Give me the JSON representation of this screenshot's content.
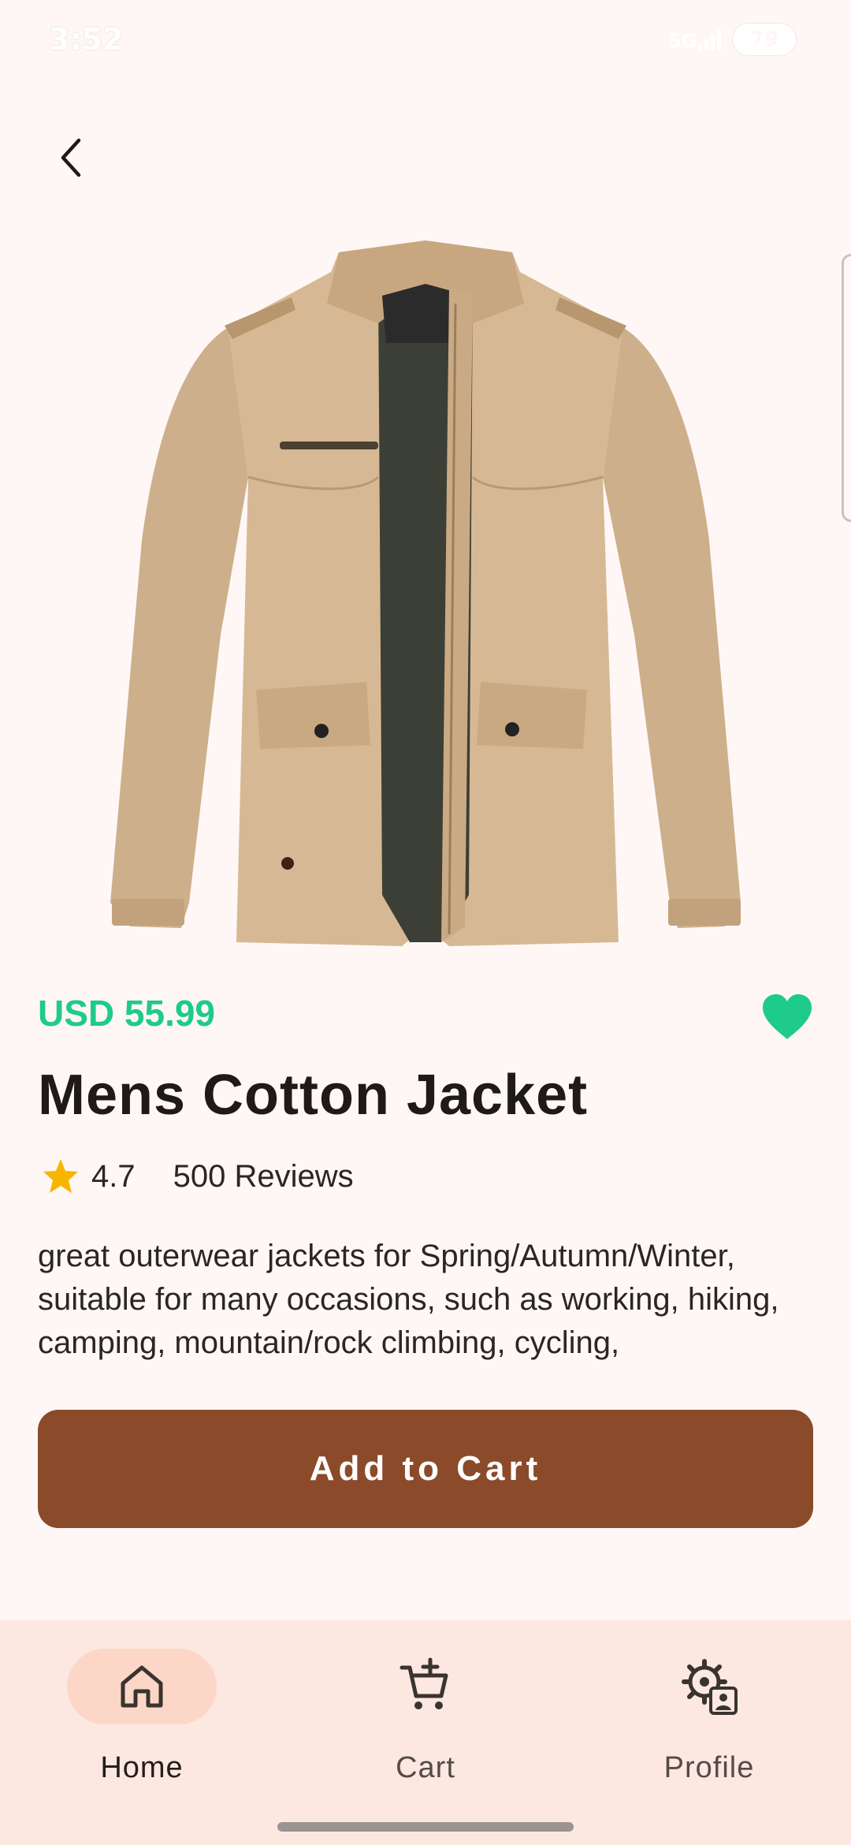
{
  "status_bar": {
    "time": "3:52",
    "battery": "79"
  },
  "product": {
    "price": "USD 55.99",
    "title": "Mens Cotton Jacket",
    "rating": "4.7",
    "reviews": "500 Reviews",
    "description": "great outerwear jackets for Spring/Autumn/Winter, suitable for many occasions, such as working, hiking, camping, mountain/rock climbing, cycling,",
    "is_favorite": true
  },
  "actions": {
    "add_to_cart_label": "Add to Cart"
  },
  "nav": {
    "items": [
      {
        "label": "Home",
        "icon": "home-icon",
        "active": true
      },
      {
        "label": "Cart",
        "icon": "cart-add-icon",
        "active": false
      },
      {
        "label": "Profile",
        "icon": "settings-account-icon",
        "active": false
      }
    ]
  },
  "colors": {
    "background": "#FEF7F5",
    "price": "#1ECB88",
    "favorite": "#1ECB88",
    "button": "#8B4A2A",
    "nav_background": "#FCE8E1",
    "nav_active_pill": "#FCD7C8",
    "star": "#F7B500"
  }
}
